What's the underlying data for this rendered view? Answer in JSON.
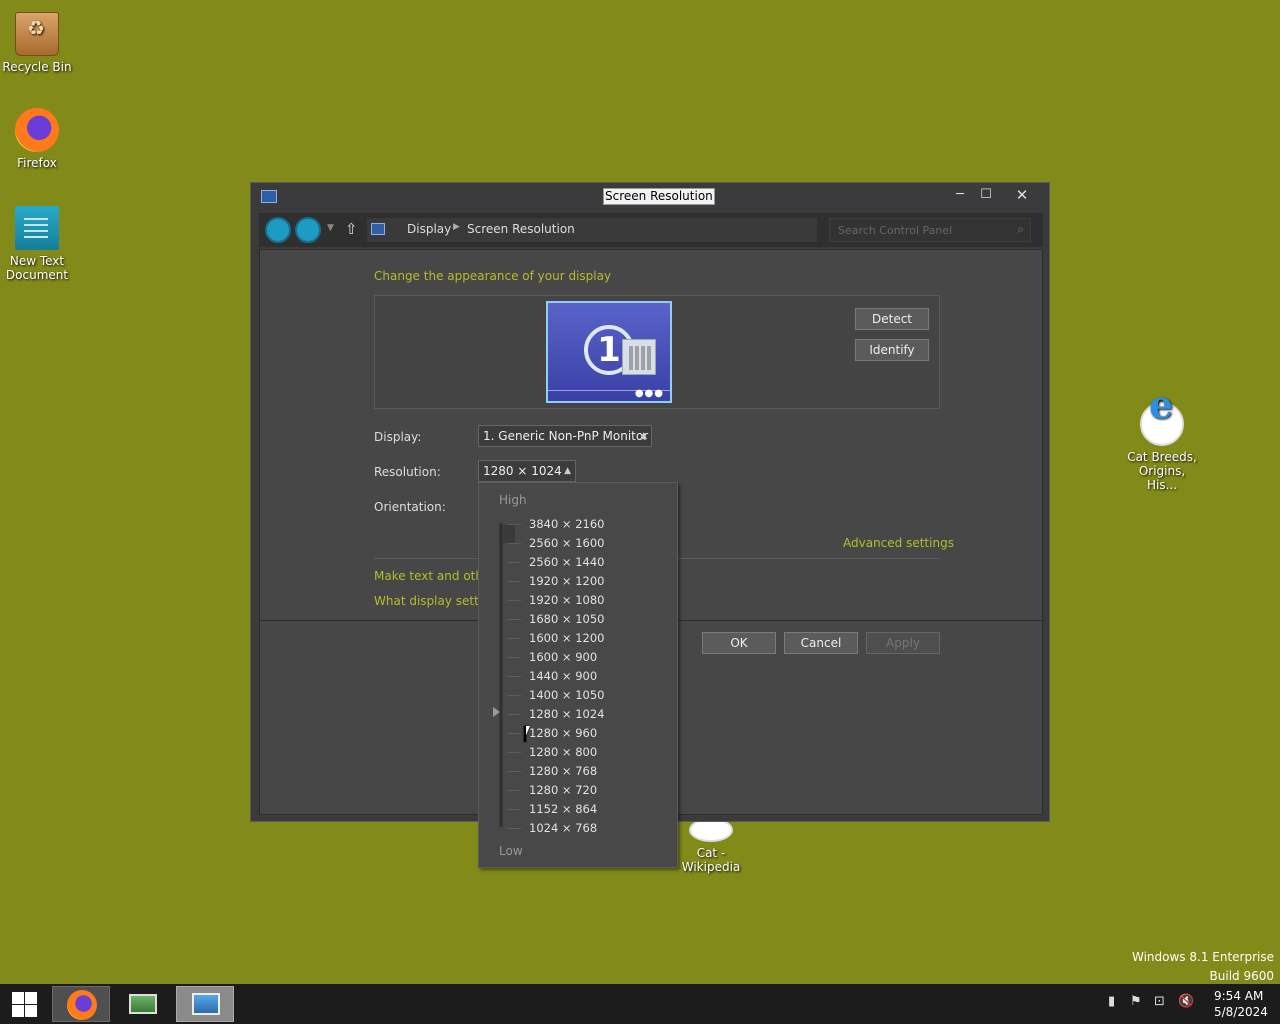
{
  "desktop": {
    "icons": [
      {
        "label": "Recycle Bin"
      },
      {
        "label": "Firefox"
      },
      {
        "label": "New Text Document"
      },
      {
        "label": "Cat Breeds, Origins, His..."
      },
      {
        "label": "Cat - Wikipedia"
      }
    ],
    "watermark": {
      "line1": "Windows 8.1 Enterprise",
      "line2": "Build 9600"
    }
  },
  "window": {
    "title": "Screen Resolution",
    "controls": {
      "minimize": "─",
      "maximize": "☐",
      "close": "✕"
    }
  },
  "addressbar": {
    "breadcrumb": [
      "Display",
      "Screen Resolution"
    ],
    "search_placeholder": "Search Control Panel"
  },
  "main": {
    "heading": "Change the appearance of your display",
    "monitor_number": "1",
    "detect_label": "Detect",
    "identify_label": "Identify",
    "display_label": "Display:",
    "display_value": "1. Generic Non-PnP Monitor",
    "resolution_label": "Resolution:",
    "resolution_value": "1280 × 1024",
    "orientation_label": "Orientation:",
    "advanced_link": "Advanced settings",
    "text_link": "Make text and other",
    "what_link": "What display setting",
    "ok_label": "OK",
    "cancel_label": "Cancel",
    "apply_label": "Apply"
  },
  "dropdown": {
    "high_label": "High",
    "low_label": "Low",
    "selected": "1280 × 1024",
    "options": [
      "3840 × 2160",
      "2560 × 1600",
      "2560 × 1440",
      "1920 × 1200",
      "1920 × 1080",
      "1680 × 1050",
      "1600 × 1200",
      "1600 × 900",
      "1440 × 900",
      "1400 × 1050",
      "1280 × 1024",
      "1280 × 960",
      "1280 × 800",
      "1280 × 768",
      "1280 × 720",
      "1152 × 864",
      "1024 × 768"
    ]
  },
  "taskbar": {
    "clock_time": "9:54 AM",
    "clock_date": "5/8/2024"
  },
  "colors": {
    "desktop": "#828a1a",
    "accent_link": "#b4bd2a"
  }
}
